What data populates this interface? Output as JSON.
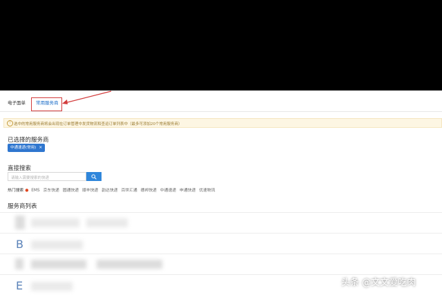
{
  "tabs": [
    {
      "label": "电子面单"
    },
    {
      "label": "常用服务商"
    }
  ],
  "notice": {
    "text": "选中的常用服务商将会出现在订单管理中发货物流和查运订单列表中（最多可添加20个常用服务商）"
  },
  "selected": {
    "title": "已选择的服务商",
    "chip_label": "中通速递(常用)",
    "chip_close": "×"
  },
  "search": {
    "title": "直接搜索",
    "placeholder": "请输入需要搜索的快递"
  },
  "hot": {
    "label": "热门搜索",
    "items": [
      "EMS",
      "京东快递",
      "圆通快递",
      "顺丰快递",
      "韵达快递",
      "百世汇通",
      "德邦快递",
      "中通速递",
      "申通快递",
      "优速物流"
    ]
  },
  "provider_list": {
    "title": "服务商列表",
    "rows": [
      {
        "letter": ""
      },
      {
        "letter": "B"
      },
      {
        "letter": ""
      },
      {
        "letter": "E"
      }
    ]
  },
  "watermark": "头条 @文文爱吃肉",
  "colors": {
    "accent": "#2f76cf",
    "highlight": "#d23b3b",
    "notice_bg": "#fdf6e3"
  }
}
